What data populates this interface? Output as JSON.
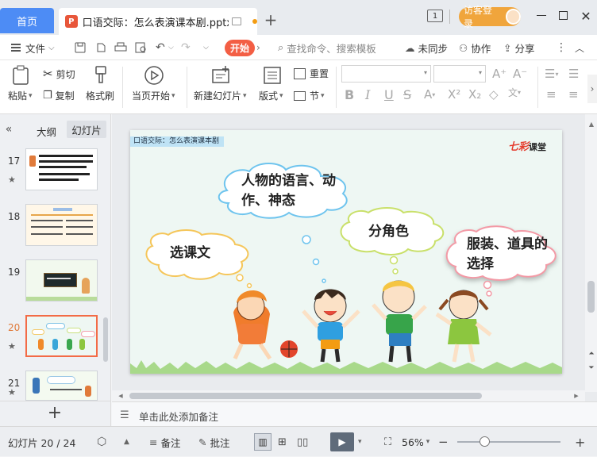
{
  "tabs": {
    "home": "首页",
    "doc": "口语交际：怎么表演课本剧.pptx",
    "doc_icon": "P"
  },
  "window": {
    "page_counter_icon": "1",
    "login": "访客登录"
  },
  "menu": {
    "file": "文件",
    "start": "开始",
    "search_placeholder": "查找命令、搜索模板",
    "unsync": "未同步",
    "collab": "协作",
    "share": "分享"
  },
  "ribbon": {
    "paste": "粘贴",
    "cut": "剪切",
    "copy": "复制",
    "format_painter": "格式刷",
    "play_current": "当页开始",
    "new_slide": "新建幻灯片",
    "layout": "版式",
    "reset": "重置",
    "section": "节"
  },
  "panel": {
    "tab_outline": "大纲",
    "tab_slides": "幻灯片",
    "slides": [
      {
        "num": "17",
        "star": "★"
      },
      {
        "num": "18",
        "star": ""
      },
      {
        "num": "19",
        "star": ""
      },
      {
        "num": "20",
        "star": "★"
      },
      {
        "num": "21",
        "star": "★"
      }
    ],
    "add": "+"
  },
  "slide": {
    "header": "口语交际：怎么表演课本剧",
    "logo_prefix": "七彩",
    "logo_suffix": "课堂",
    "bubbles": [
      "人物的语言、动作、神态",
      "选课文",
      "分角色",
      "服装、道具的选择"
    ]
  },
  "notes": {
    "placeholder": "单击此处添加备注"
  },
  "status": {
    "slide_count": "幻灯片 20 / 24",
    "notes": "备注",
    "comments": "批注",
    "zoom": "56%"
  },
  "colors": {
    "accent": "#4d8cf5",
    "brand_orange": "#f35e44",
    "login": "#f0a53c",
    "selected_thumb": "#f36b46"
  }
}
